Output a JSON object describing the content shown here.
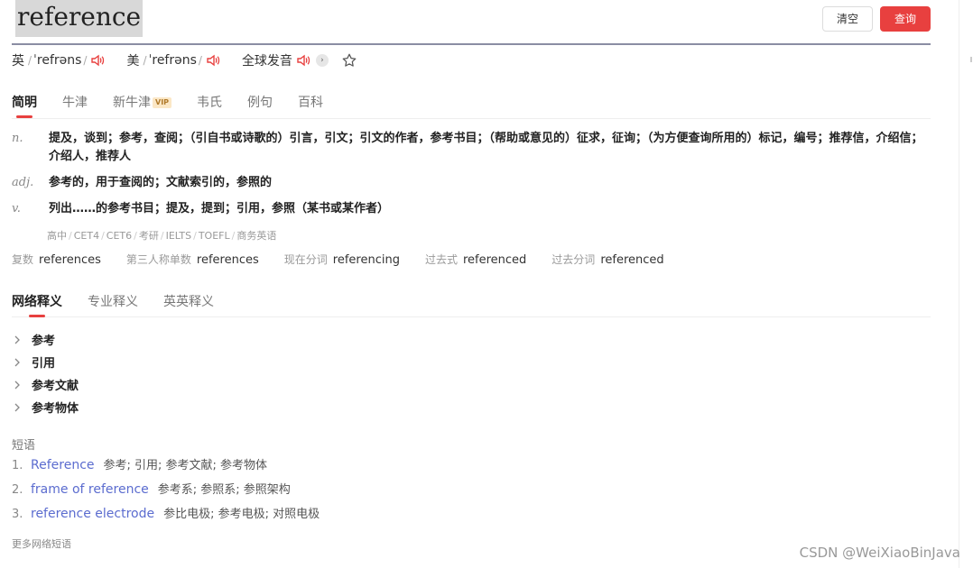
{
  "search": {
    "query": "reference",
    "clear_label": "清空",
    "search_label": "查询"
  },
  "pronunciation": {
    "uk": {
      "label": "英",
      "ipa": "ˈrefrəns"
    },
    "us": {
      "label": "美",
      "ipa": "ˈrefrəns"
    },
    "global_label": "全球发音",
    "speaker_icon": "speaker-icon",
    "favorite_icon": "star-icon"
  },
  "dict_tabs": [
    {
      "label": "简明",
      "active": true
    },
    {
      "label": "牛津",
      "active": false
    },
    {
      "label": "新牛津",
      "badge": "VIP",
      "active": false
    },
    {
      "label": "韦氏",
      "active": false
    },
    {
      "label": "例句",
      "active": false
    },
    {
      "label": "百科",
      "active": false
    }
  ],
  "definitions": [
    {
      "pos": "n.",
      "text": "提及，谈到；参考，查阅；（引自书或诗歌的）引言，引文；引文的作者，参考书目；（帮助或意见的）征求，征询；（为方便查询所用的）标记，编号；推荐信，介绍信；介绍人，推荐人"
    },
    {
      "pos": "adj.",
      "text": "参考的，用于查阅的；文献索引的，参照的"
    },
    {
      "pos": "v.",
      "text": "列出……的参考书目；提及，提到；引用，参照（某书或某作者）"
    }
  ],
  "exam_tags": [
    "高中",
    "CET4",
    "CET6",
    "考研",
    "IELTS",
    "TOEFL",
    "商务英语"
  ],
  "word_forms": [
    {
      "label": "复数",
      "value": "references"
    },
    {
      "label": "第三人称单数",
      "value": "references"
    },
    {
      "label": "现在分词",
      "value": "referencing"
    },
    {
      "label": "过去式",
      "value": "referenced"
    },
    {
      "label": "过去分词",
      "value": "referenced"
    }
  ],
  "web_tabs": [
    {
      "label": "网络释义",
      "active": true
    },
    {
      "label": "专业释义",
      "active": false
    },
    {
      "label": "英英释义",
      "active": false
    }
  ],
  "web_definitions": [
    "参考",
    "引用",
    "参考文献",
    "参考物体"
  ],
  "phrases_title": "短语",
  "phrases": [
    {
      "num": "1.",
      "phrase": "Reference",
      "meaning": "参考; 引用; 参考文献; 参考物体"
    },
    {
      "num": "2.",
      "phrase": "frame of reference",
      "meaning": "参考系; 参照系; 参照架构"
    },
    {
      "num": "3.",
      "phrase": "reference electrode",
      "meaning": "参比电极; 参考电极; 对照电极"
    }
  ],
  "more_phrases": "更多网络短语",
  "watermark": "CSDN @WeiXiaoBinJava",
  "colors": {
    "accent_red": "#e8403f",
    "link_blue": "#5b6ccf",
    "speaker_red": "#e8403f"
  }
}
